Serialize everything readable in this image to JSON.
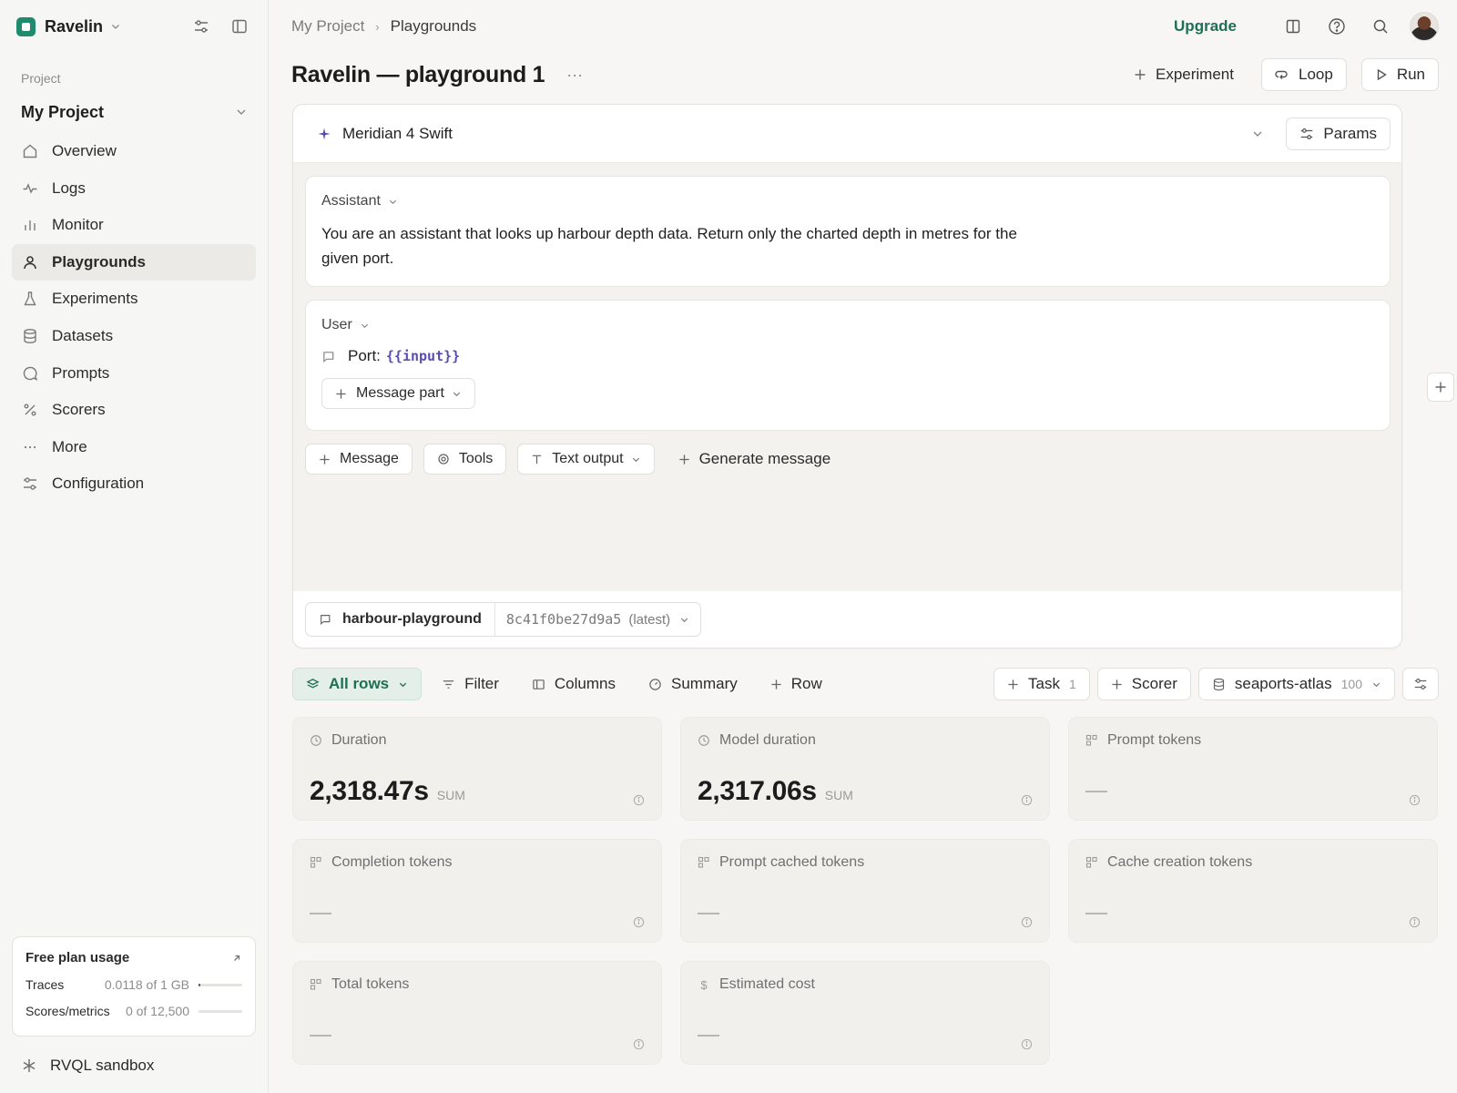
{
  "app": {
    "brand": "Ravelin"
  },
  "sidebar": {
    "section_label": "Project",
    "project_name": "My Project",
    "nav": [
      {
        "label": "Overview",
        "icon": "home-icon"
      },
      {
        "label": "Logs",
        "icon": "activity-icon"
      },
      {
        "label": "Monitor",
        "icon": "bar-chart-icon"
      },
      {
        "label": "Playgrounds",
        "icon": "user-icon",
        "active": true
      },
      {
        "label": "Experiments",
        "icon": "flask-icon"
      },
      {
        "label": "Datasets",
        "icon": "database-icon"
      },
      {
        "label": "Prompts",
        "icon": "chat-bubble-icon"
      },
      {
        "label": "Scorers",
        "icon": "percent-icon"
      },
      {
        "label": "More",
        "icon": "ellipsis-icon"
      },
      {
        "label": "Configuration",
        "icon": "sliders-icon"
      }
    ],
    "usage": {
      "title": "Free plan usage",
      "rows": [
        {
          "label": "Traces",
          "value": "0.0118 of 1 GB",
          "fraction": 0.0118
        },
        {
          "label": "Scores/metrics",
          "value": "0 of 12,500",
          "fraction": 0
        }
      ]
    },
    "sandbox_label": "RVQL sandbox"
  },
  "header": {
    "breadcrumb": [
      "My Project",
      "Playgrounds"
    ],
    "upgrade_label": "Upgrade"
  },
  "page": {
    "title": "Ravelin — playground 1",
    "experiment_label": "Experiment",
    "loop_label": "Loop",
    "run_label": "Run"
  },
  "prompt": {
    "model_name": "Meridian 4 Swift",
    "params_label": "Params",
    "assistant": {
      "role": "Assistant",
      "text": "You are an assistant that looks up harbour depth data. Return only the charted depth in metres for the given port."
    },
    "user": {
      "role": "User",
      "prefix": "Port:",
      "variable": "{{input}}",
      "message_part_label": "Message part"
    },
    "actions": {
      "message_label": "Message",
      "tools_label": "Tools",
      "text_output_label": "Text output",
      "generate_label": "Generate message"
    },
    "dataset": {
      "name": "harbour-playground",
      "version": "8c41f0be27d9a5",
      "version_tag": "(latest)"
    }
  },
  "toolbar": {
    "all_rows_label": "All rows",
    "filter_label": "Filter",
    "columns_label": "Columns",
    "summary_label": "Summary",
    "row_label": "Row",
    "task_label": "Task",
    "task_count": "1",
    "scorer_label": "Scorer",
    "dataset_label": "seaports-atlas",
    "dataset_count": "100"
  },
  "metrics": [
    {
      "label": "Duration",
      "icon": "clock-icon",
      "value": "2,318.47s",
      "unit": "SUM"
    },
    {
      "label": "Model duration",
      "icon": "clock-icon",
      "value": "2,317.06s",
      "unit": "SUM"
    },
    {
      "label": "Prompt tokens",
      "icon": "token-icon",
      "value": null
    },
    {
      "label": "Completion tokens",
      "icon": "token-icon",
      "value": null
    },
    {
      "label": "Prompt cached tokens",
      "icon": "token-icon",
      "value": null
    },
    {
      "label": "Cache creation tokens",
      "icon": "token-icon",
      "value": null
    },
    {
      "label": "Total tokens",
      "icon": "token-icon",
      "value": null
    },
    {
      "label": "Estimated cost",
      "icon": "dollar-icon",
      "value": null
    }
  ],
  "colors": {
    "accent": "#1f6f57",
    "brand": "#1f8a6d",
    "variable": "#5a4db0"
  }
}
